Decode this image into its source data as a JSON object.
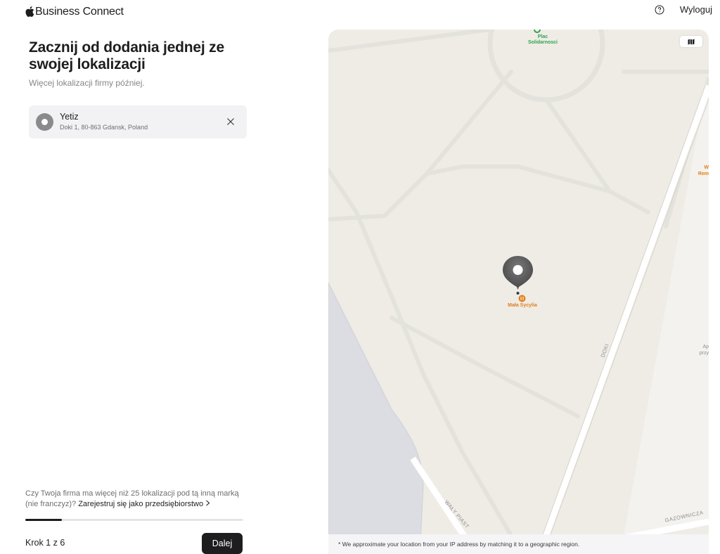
{
  "header": {
    "brand": "Business Connect",
    "help_icon": "question-circle-icon",
    "logout_label": "Wyloguj"
  },
  "main": {
    "title": "Zacznij od dodania jednej ze swojej lokalizacji",
    "subtitle": "Więcej lokalizacji firmy później.",
    "location": {
      "name": "Yetiz",
      "address": "Doki 1, 80-863 Gdansk, Poland",
      "icon": "location-pin-icon"
    }
  },
  "footer": {
    "enterprise_text": "Czy Twoja firma ma więcej niż 25 lokalizacji pod tą inną marką (nie franczyz)? ",
    "enterprise_link": "Zarejestruj się jako przedsiębiorstwo",
    "step_label": "Krok 1 z 6",
    "next_label": "Dalej",
    "progress_fraction": 0.167
  },
  "map": {
    "poi_plac": "Plac Solidarnosci",
    "poi_mala": "Mała Sycylia",
    "poi_rem_top": "W",
    "poi_rem": "Rem",
    "poi_ap": "Ap",
    "poi_przy": "przy",
    "street_doki": "DOKI",
    "street_waly": "WAŁY PIAST",
    "street_gazow": "GAZOWNICZA",
    "footer_note": "* We approximate your location from your IP address by matching it to a geographic region.",
    "toggle_icon": "map-icon",
    "colors": {
      "land": "#efece6",
      "road": "#ffffff",
      "water": "#dcdde2",
      "poi_green": "#2ea44f",
      "poi_orange": "#e0801b"
    }
  }
}
